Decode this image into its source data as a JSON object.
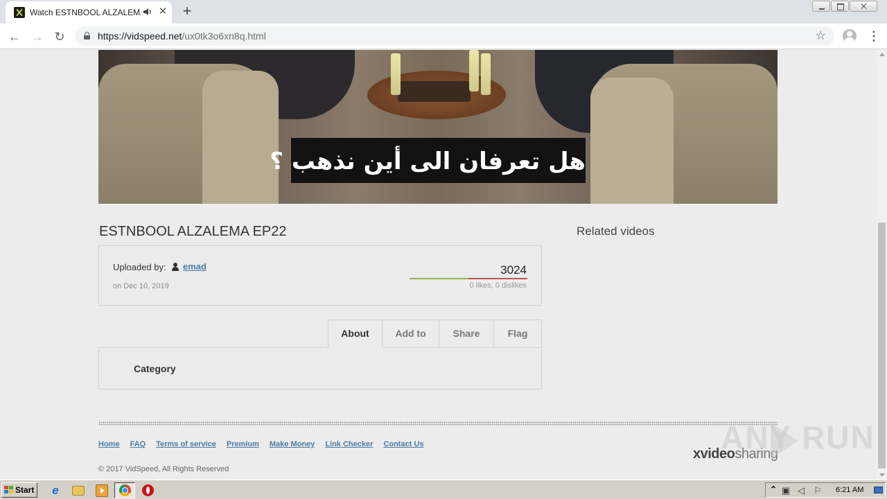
{
  "browser": {
    "tab_title": "Watch ESTNBOOL ALZALEMA EP22",
    "tab_close": "✕",
    "new_tab": "+",
    "url_host": "https://vidspeed.net",
    "url_path": "/ux0tk3o6xn8q.html",
    "nav_back": "←",
    "nav_forward": "→",
    "nav_reload": "↻",
    "bookmark_star": "☆",
    "menu_dots": "⋮"
  },
  "video": {
    "subtitle": "هل تعرفان الى أين نذهب ؟",
    "title": "ESTNBOOL ALZALEMA EP22"
  },
  "info": {
    "uploaded_label": "Uploaded by:",
    "uploader": "emad",
    "date": "on Dec 10, 2019",
    "views": "3024",
    "votes": "0 likes, 0 dislikes",
    "likes_fraction": 0.5
  },
  "tabs": [
    {
      "label": "About"
    },
    {
      "label": "Add to"
    },
    {
      "label": "Share"
    },
    {
      "label": "Flag"
    }
  ],
  "about": {
    "category_label": "Category"
  },
  "related": {
    "title": "Related videos"
  },
  "footer": {
    "links": [
      {
        "label": "Home"
      },
      {
        "label": "FAQ"
      },
      {
        "label": "Terms of service"
      },
      {
        "label": "Premium"
      },
      {
        "label": "Make Money"
      },
      {
        "label": "Link Checker"
      },
      {
        "label": "Contact Us"
      }
    ],
    "copyright": "© 2017 VidSpeed, All Rights Reserved",
    "brand_bold": "xvideo",
    "brand_rest": "sharing"
  },
  "watermark": {
    "text": "ANY RUN"
  },
  "taskbar": {
    "start_label": "Start",
    "clock": "6:21 AM",
    "tray_arrow": "⌃"
  },
  "colors": {
    "link": "#4a7ca6",
    "like": "#93b04f",
    "dislike": "#c5504b",
    "page_bg": "#ececec"
  }
}
